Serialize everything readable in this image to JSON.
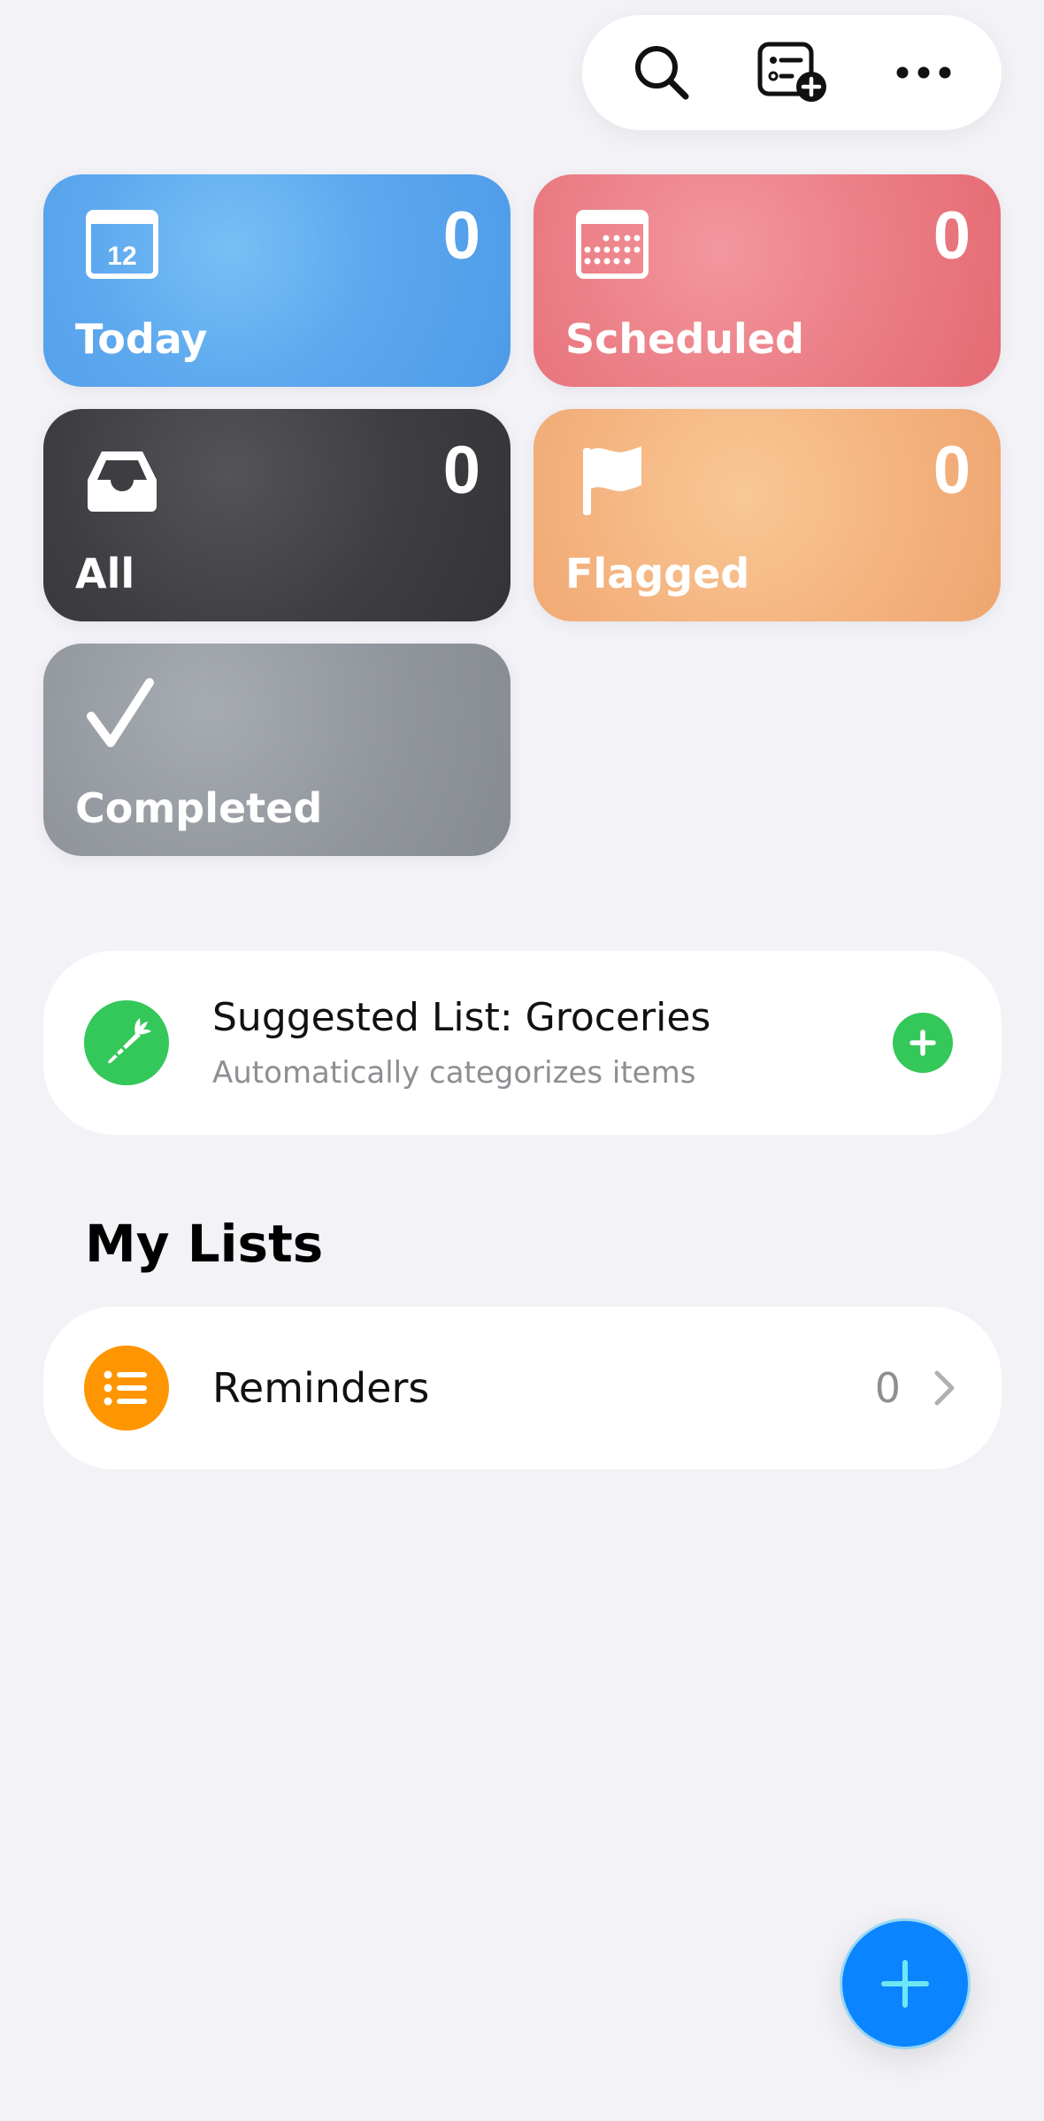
{
  "toolbar": {
    "search_icon": "search-icon",
    "add_list_icon": "add-list-icon",
    "more_icon": "more-icon"
  },
  "smart_lists": {
    "today": {
      "label": "Today",
      "count": "0",
      "calendar_day": "12",
      "color": "#5DA8EE"
    },
    "scheduled": {
      "label": "Scheduled",
      "count": "0",
      "color": "#EB7E86"
    },
    "all": {
      "label": "All",
      "count": "0",
      "color": "#3E3D42"
    },
    "flagged": {
      "label": "Flagged",
      "count": "0",
      "color": "#F4B37F"
    },
    "completed": {
      "label": "Completed",
      "color": "#92969D"
    }
  },
  "suggested": {
    "title": "Suggested List: Groceries",
    "subtitle": "Automatically categorizes items",
    "icon": "carrot-icon",
    "accent": "#34C759"
  },
  "my_lists": {
    "title": "My Lists",
    "items": [
      {
        "label": "Reminders",
        "count": "0",
        "icon": "list-bullet-icon",
        "color": "#FF9500"
      }
    ]
  },
  "fab": {
    "icon": "plus-icon",
    "color": "#0A84FF"
  }
}
